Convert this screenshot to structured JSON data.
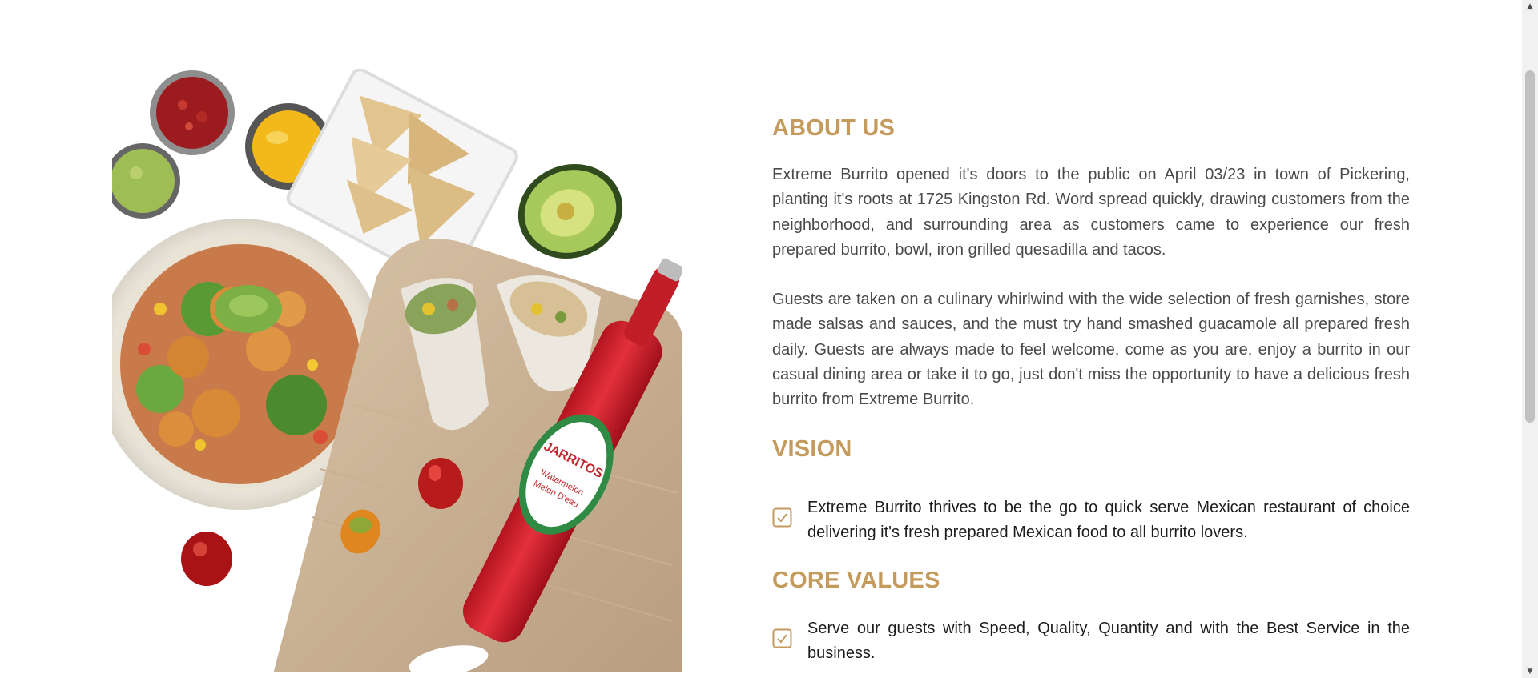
{
  "image": {
    "alt_icon": "food-spread-image"
  },
  "about": {
    "heading": "ABOUT US",
    "paragraph_1": "Extreme Burrito opened it's doors to the public on April 03/23 in town of Pickering, planting it's roots at 1725 Kingston Rd. Word spread quickly, drawing customers from the neighborhood, and surrounding area as customers came to experience our fresh prepared burrito, bowl, iron grilled quesadilla and tacos.",
    "paragraph_2": "Guests are taken on a culinary whirlwind with the wide selection of fresh garnishes, store made salsas and sauces, and the must try hand smashed guacamole all prepared fresh daily. Guests are always made to feel welcome, come as you are, enjoy a burrito in our casual dining area or take it to go, just don't miss the opportunity to have a delicious fresh burrito from Extreme Burrito."
  },
  "vision": {
    "heading": "VISION",
    "items": [
      "Extreme Burrito thrives to be the go to quick serve Mexican restaurant of choice delivering it's fresh prepared Mexican food to all burrito lovers."
    ]
  },
  "core_values": {
    "heading": "CORE VALUES",
    "items": [
      "Serve our guests with Speed, Quality, Quantity and with the Best Service in the business."
    ]
  },
  "bottle_label": {
    "brand": "JARRITOS",
    "flavor_line_1": "Watermelon",
    "flavor_line_2": "Melon D'eau"
  },
  "colors": {
    "accent": "#c49a5d",
    "body_text": "#4a4a4a",
    "list_text": "#1c1c1c",
    "background": "#ffffff"
  }
}
